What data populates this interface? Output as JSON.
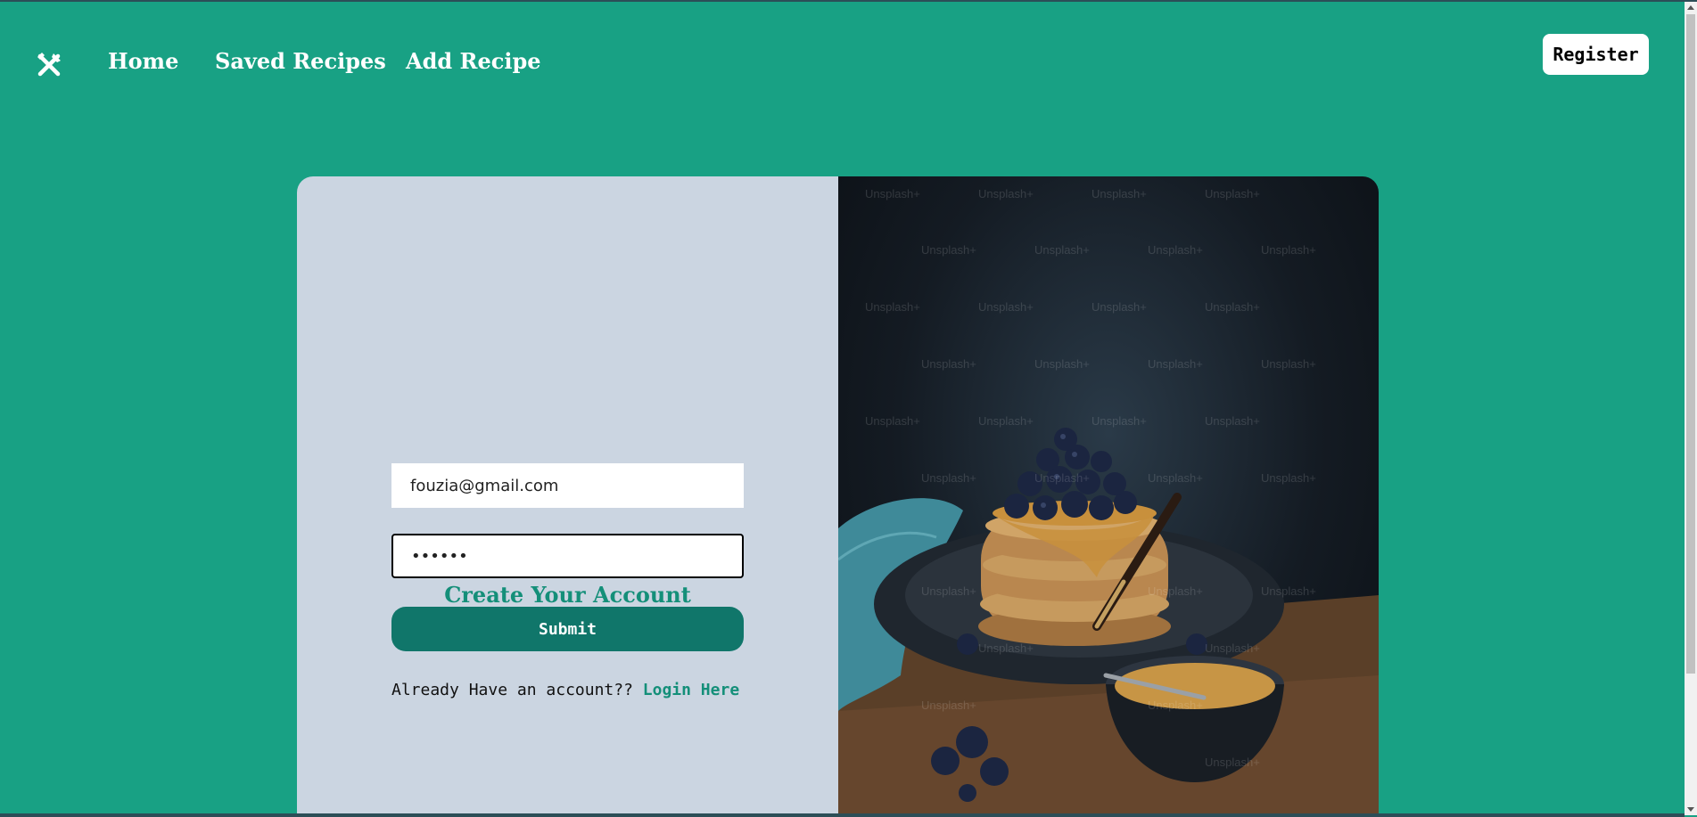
{
  "nav": {
    "logo_icon": "fork-knife-icon",
    "links": [
      "Home",
      "Saved Recipes",
      "Add Recipe"
    ],
    "register_label": "Register"
  },
  "form": {
    "title": "Create Your Account",
    "email_value": "fouzia@gmail.com",
    "password_value": "••••••",
    "submit_label": "Submit",
    "already_text": "Already Have an account??",
    "login_link": "Login Here"
  },
  "image": {
    "watermark_text": "Unsplash+"
  },
  "colors": {
    "background": "#18a184",
    "form_panel": "#cbd5e1",
    "accent": "#148f79",
    "submit_button": "#10766a"
  }
}
